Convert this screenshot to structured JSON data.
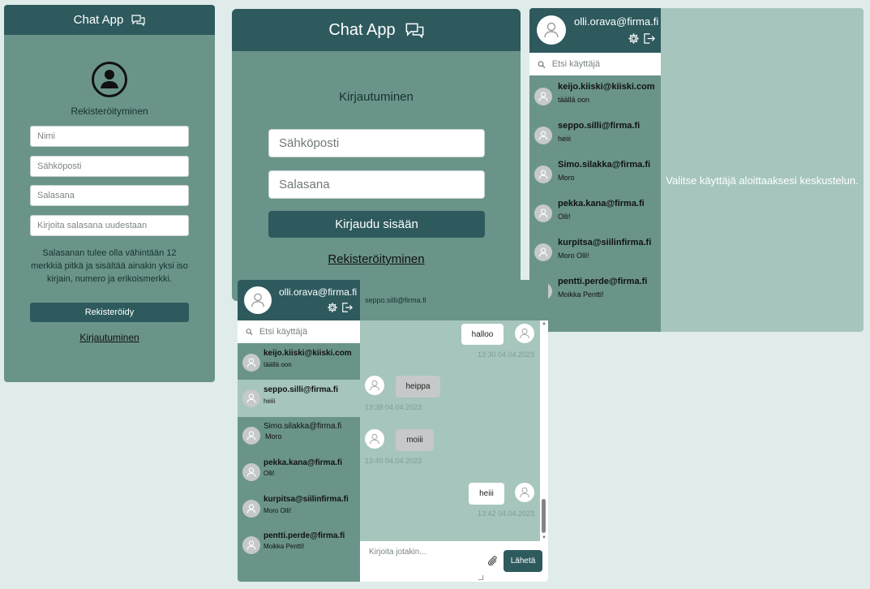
{
  "colors": {
    "header": "#2e5a5e",
    "panel": "#6a9489",
    "chat_bg": "#a6c5bd",
    "page_bg": "#dfecea"
  },
  "register": {
    "app_title": "Chat App",
    "title": "Rekisteröityminen",
    "name_placeholder": "Nimi",
    "email_placeholder": "Sähköposti",
    "password_placeholder": "Salasana",
    "password_repeat_placeholder": "Kirjoita salasana uudestaan",
    "note": "Salasanan tulee olla vähintään 12 merkkiä pitkä ja sisältää ainakin yksi iso kirjain, numero ja erikoismerkki.",
    "submit_label": "Rekisteröidy",
    "login_link": "Kirjautuminen"
  },
  "login": {
    "app_title": "Chat App",
    "title": "Kirjautuminen",
    "email_placeholder": "Sähköposti",
    "password_placeholder": "Salasana",
    "submit_label": "Kirjaudu sisään",
    "register_link": "Rekisteröityminen"
  },
  "chat": {
    "current_user": "olli.orava@firma.fi",
    "search_placeholder": "Etsi käyttäjä",
    "contacts": [
      {
        "name": "keijo.kiiski@kiiski.com",
        "last_message": "täällä oon"
      },
      {
        "name": "seppo.silli@firma.fi",
        "last_message": "heiii"
      },
      {
        "name": "Simo.silakka@firma.fi",
        "last_message": "Moro"
      },
      {
        "name": "pekka.kana@firma.fi",
        "last_message": "Olli!"
      },
      {
        "name": "kurpitsa@siilinfirma.fi",
        "last_message": "Moro Olli!"
      },
      {
        "name": "pentti.perde@firma.fi",
        "last_message": "Moikka Pentti!"
      }
    ],
    "empty_state": "Valitse käyttäjä aloittaaksesi keskustelun.",
    "active_chat": {
      "with": "seppo.silli@firma.fi",
      "messages": [
        {
          "text": "halloo",
          "time": "13:30 04.04.2023",
          "direction": "out"
        },
        {
          "text": "heippa",
          "time": "13:38 04.04.2023",
          "direction": "in"
        },
        {
          "text": "moiii",
          "time": "13:40 04.04.2023",
          "direction": "in"
        },
        {
          "text": "heiii",
          "time": "13:42 04.04.2023",
          "direction": "out"
        }
      ],
      "composer_placeholder": "Kirjoita jotakin...",
      "send_label": "Lähetä"
    }
  }
}
